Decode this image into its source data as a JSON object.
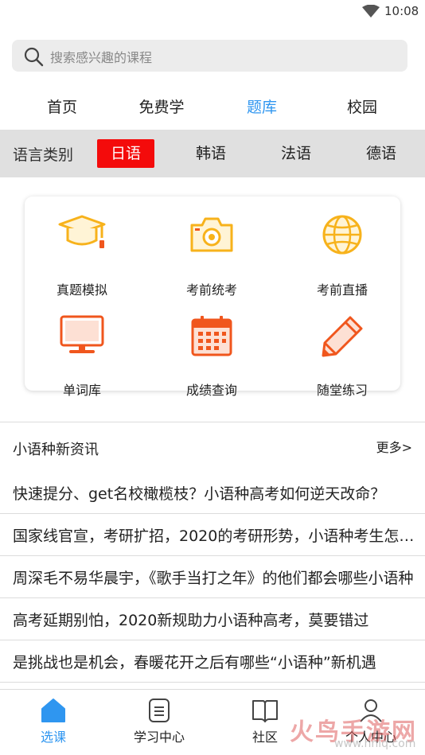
{
  "status_bar": {
    "time": "10:08",
    "icons": [
      "wifi-icon"
    ]
  },
  "search": {
    "placeholder": "搜索感兴趣的课程",
    "icon": "search-icon"
  },
  "top_nav": [
    {
      "label": "首页",
      "active": false
    },
    {
      "label": "免费学",
      "active": false
    },
    {
      "label": "题库",
      "active": true
    },
    {
      "label": "校园",
      "active": false
    }
  ],
  "language": {
    "title": "语言类别",
    "items": [
      {
        "label": "日语",
        "active": true
      },
      {
        "label": "韩语",
        "active": false
      },
      {
        "label": "法语",
        "active": false
      },
      {
        "label": "德语",
        "active": false
      }
    ]
  },
  "tiles": [
    {
      "label": "真题模拟",
      "icon": "graduation-cap-icon"
    },
    {
      "label": "考前统考",
      "icon": "camera-icon"
    },
    {
      "label": "考前直播",
      "icon": "globe-icon"
    },
    {
      "label": "单词库",
      "icon": "monitor-icon"
    },
    {
      "label": "成绩查询",
      "icon": "calendar-icon"
    },
    {
      "label": "随堂练习",
      "icon": "pencil-icon"
    }
  ],
  "news": {
    "title": "小语种新资讯",
    "more": "更多>",
    "items": [
      "快速提分、get名校橄榄枝？小语种高考如何逆天改命？",
      "国家线官宣，考研扩招，2020的考研形势，小语种考生怎么办",
      "周深毛不易华晨宇，《歌手当打之年》的他们都会哪些小语种",
      "高考延期别怕，2020新规助力小语种高考，莫要错过",
      "是挑战也是机会，春暖花开之后有哪些“小语种”新机遇"
    ]
  },
  "bottom_nav": [
    {
      "label": "选课",
      "icon": "home-icon",
      "active": true
    },
    {
      "label": "学习中心",
      "icon": "document-icon",
      "active": false
    },
    {
      "label": "社区",
      "icon": "book-icon",
      "active": false
    },
    {
      "label": "个人中心",
      "icon": "person-icon",
      "active": false
    }
  ],
  "watermark": {
    "text": "火鸟手游网",
    "url": "www.hnlq.com"
  },
  "colors": {
    "accent": "#2f96f0",
    "language_active": "#f40b0b",
    "icon_orange": "#f7b21b",
    "icon_red": "#f0561d"
  }
}
